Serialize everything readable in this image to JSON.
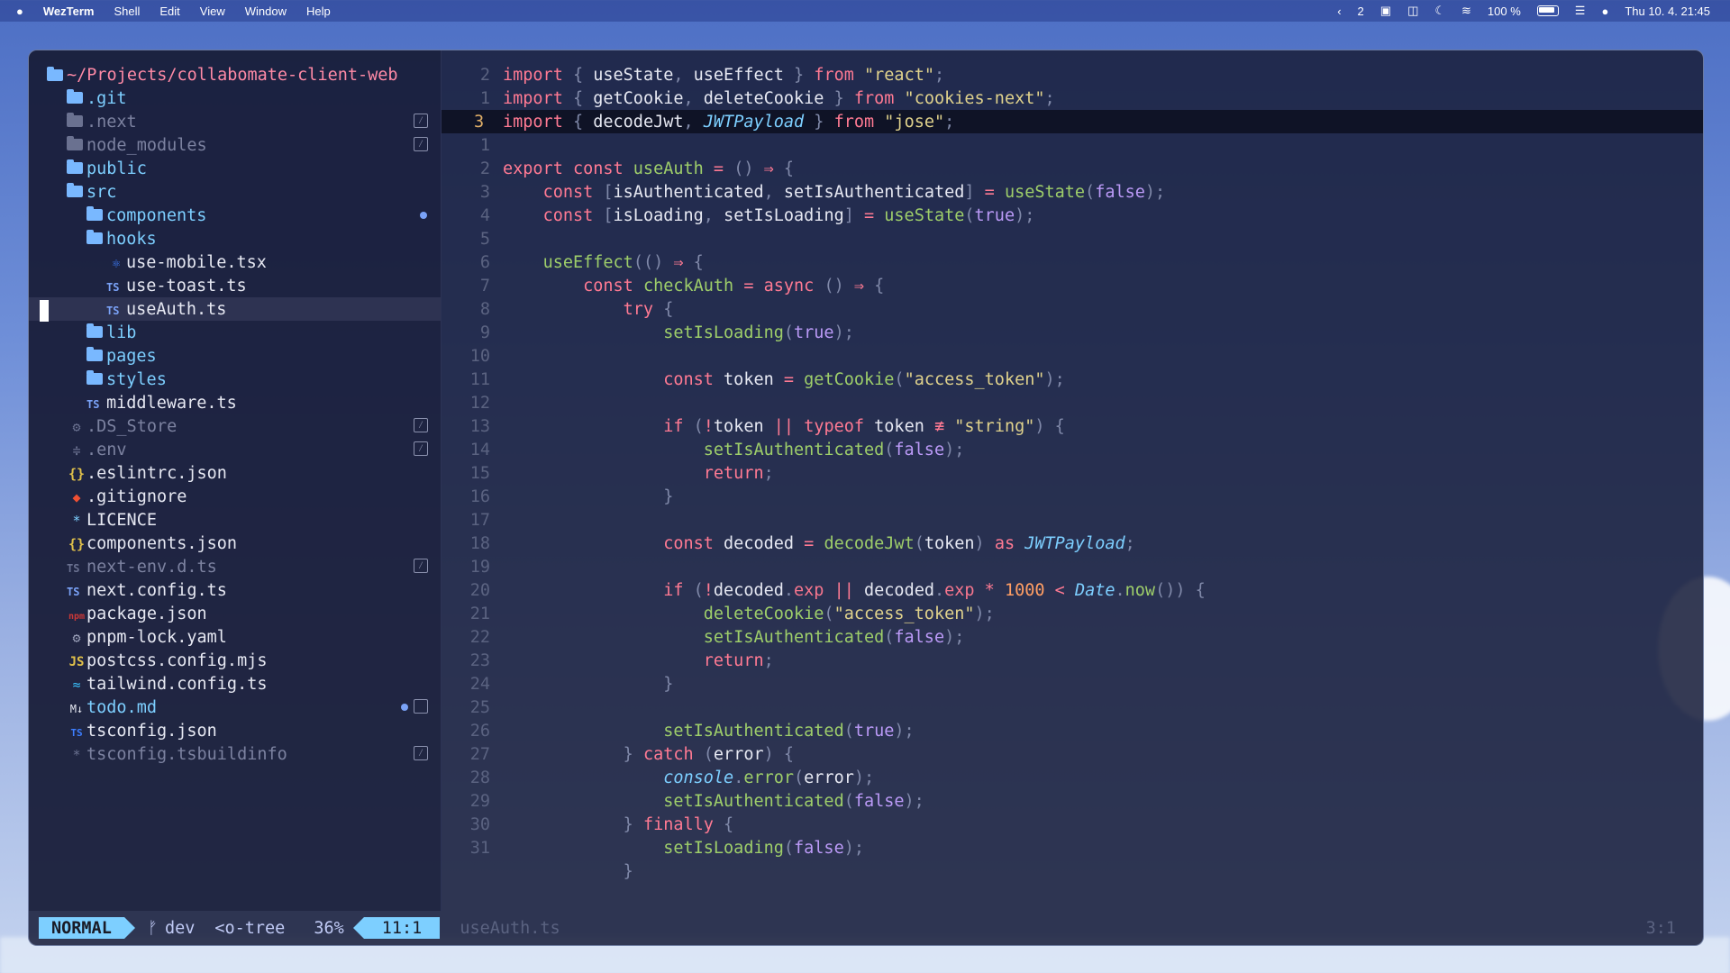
{
  "menubar": {
    "app": "WezTerm",
    "menus": [
      "Shell",
      "Edit",
      "View",
      "Window",
      "Help"
    ],
    "space_number": "2",
    "battery": "100 %",
    "datetime": "Thu 10. 4.  21:45"
  },
  "tree": {
    "root": "~/Projects/collabomate-client-web",
    "items": [
      {
        "name": ".git",
        "type": "folder",
        "depth": 1
      },
      {
        "name": ".next",
        "type": "folder-dim",
        "depth": 1,
        "ignored": true
      },
      {
        "name": "node_modules",
        "type": "folder-dim",
        "depth": 1,
        "ignored": true
      },
      {
        "name": "public",
        "type": "folder",
        "depth": 1
      },
      {
        "name": "src",
        "type": "folder-open",
        "depth": 1
      },
      {
        "name": "components",
        "type": "folder",
        "depth": 2,
        "modified": true
      },
      {
        "name": "hooks",
        "type": "folder-open",
        "depth": 2
      },
      {
        "name": "use-mobile.tsx",
        "type": "tsx",
        "depth": 3
      },
      {
        "name": "use-toast.ts",
        "type": "ts",
        "depth": 3
      },
      {
        "name": "useAuth.ts",
        "type": "ts",
        "depth": 3,
        "selected": true
      },
      {
        "name": "lib",
        "type": "folder",
        "depth": 2
      },
      {
        "name": "pages",
        "type": "folder",
        "depth": 2
      },
      {
        "name": "styles",
        "type": "folder",
        "depth": 2
      },
      {
        "name": "middleware.ts",
        "type": "ts",
        "depth": 2
      },
      {
        "name": ".DS_Store",
        "type": "gear-dim",
        "depth": 1,
        "ignored": true
      },
      {
        "name": ".env",
        "type": "env-dim",
        "depth": 1,
        "ignored": true
      },
      {
        "name": ".eslintrc.json",
        "type": "json",
        "depth": 1
      },
      {
        "name": ".gitignore",
        "type": "git",
        "depth": 1
      },
      {
        "name": "LICENCE",
        "type": "star",
        "depth": 1
      },
      {
        "name": "components.json",
        "type": "json",
        "depth": 1
      },
      {
        "name": "next-env.d.ts",
        "type": "ts-dim",
        "depth": 1,
        "ignored": true
      },
      {
        "name": "next.config.ts",
        "type": "ts",
        "depth": 1
      },
      {
        "name": "package.json",
        "type": "npm",
        "depth": 1
      },
      {
        "name": "pnpm-lock.yaml",
        "type": "gear",
        "depth": 1
      },
      {
        "name": "postcss.config.mjs",
        "type": "js",
        "depth": 1
      },
      {
        "name": "tailwind.config.ts",
        "type": "tailwind",
        "depth": 1
      },
      {
        "name": "todo.md",
        "type": "md",
        "depth": 1,
        "modified": true,
        "unchecked": true
      },
      {
        "name": "tsconfig.json",
        "type": "tsconfig",
        "depth": 1
      },
      {
        "name": "tsconfig.tsbuildinfo",
        "type": "star-dim",
        "depth": 1,
        "ignored": true
      }
    ]
  },
  "editor": {
    "lines": [
      {
        "n": "2",
        "code": [
          [
            "kw",
            "import"
          ],
          [
            "pun",
            " { "
          ],
          [
            "pl",
            "useState"
          ],
          [
            "pun",
            ", "
          ],
          [
            "pl",
            "useEffect"
          ],
          [
            "pun",
            " } "
          ],
          [
            "kw",
            "from"
          ],
          [
            "str",
            " \"react\""
          ],
          [
            "pun",
            ";"
          ]
        ]
      },
      {
        "n": "1",
        "code": [
          [
            "kw",
            "import"
          ],
          [
            "pun",
            " { "
          ],
          [
            "pl",
            "getCookie"
          ],
          [
            "pun",
            ", "
          ],
          [
            "pl",
            "deleteCookie"
          ],
          [
            "pun",
            " } "
          ],
          [
            "kw",
            "from"
          ],
          [
            "str",
            " \"cookies-next\""
          ],
          [
            "pun",
            ";"
          ]
        ]
      },
      {
        "n": "3",
        "current": true,
        "code": [
          [
            "kw",
            "import"
          ],
          [
            "pun",
            " { "
          ],
          [
            "pl",
            "decodeJwt"
          ],
          [
            "pun",
            ", "
          ],
          [
            "ty",
            "JWTPayload"
          ],
          [
            "pun",
            " } "
          ],
          [
            "kw",
            "from"
          ],
          [
            "str",
            " \"jose\""
          ],
          [
            "pun",
            ";"
          ]
        ]
      },
      {
        "n": "1",
        "code": []
      },
      {
        "n": "2",
        "code": [
          [
            "kw",
            "export const "
          ],
          [
            "fn",
            "useAuth"
          ],
          [
            "op",
            " = "
          ],
          [
            "pun",
            "() "
          ],
          [
            "op",
            "⇒"
          ],
          [
            "pun",
            " {"
          ]
        ]
      },
      {
        "n": "3",
        "code": [
          [
            "pl",
            "    "
          ],
          [
            "kw",
            "const "
          ],
          [
            "pun",
            "["
          ],
          [
            "pl",
            "isAuthenticated"
          ],
          [
            "pun",
            ", "
          ],
          [
            "pl",
            "setIsAuthenticated"
          ],
          [
            "pun",
            "]"
          ],
          [
            "op",
            " = "
          ],
          [
            "fn",
            "useState"
          ],
          [
            "pun",
            "("
          ],
          [
            "bool",
            "false"
          ],
          [
            "pun",
            ");"
          ]
        ]
      },
      {
        "n": "4",
        "code": [
          [
            "pl",
            "    "
          ],
          [
            "kw",
            "const "
          ],
          [
            "pun",
            "["
          ],
          [
            "pl",
            "isLoading"
          ],
          [
            "pun",
            ", "
          ],
          [
            "pl",
            "setIsLoading"
          ],
          [
            "pun",
            "]"
          ],
          [
            "op",
            " = "
          ],
          [
            "fn",
            "useState"
          ],
          [
            "pun",
            "("
          ],
          [
            "bool",
            "true"
          ],
          [
            "pun",
            ");"
          ]
        ]
      },
      {
        "n": "5",
        "code": []
      },
      {
        "n": "6",
        "code": [
          [
            "pl",
            "    "
          ],
          [
            "fn",
            "useEffect"
          ],
          [
            "pun",
            "(() "
          ],
          [
            "op",
            "⇒"
          ],
          [
            "pun",
            " {"
          ]
        ]
      },
      {
        "n": "7",
        "code": [
          [
            "pl",
            "        "
          ],
          [
            "kw",
            "const "
          ],
          [
            "fn",
            "checkAuth"
          ],
          [
            "op",
            " = "
          ],
          [
            "kw",
            "async"
          ],
          [
            "pun",
            " () "
          ],
          [
            "op",
            "⇒"
          ],
          [
            "pun",
            " {"
          ]
        ]
      },
      {
        "n": "8",
        "code": [
          [
            "pl",
            "            "
          ],
          [
            "kw",
            "try"
          ],
          [
            "pun",
            " {"
          ]
        ]
      },
      {
        "n": "9",
        "code": [
          [
            "pl",
            "                "
          ],
          [
            "fn",
            "setIsLoading"
          ],
          [
            "pun",
            "("
          ],
          [
            "bool",
            "true"
          ],
          [
            "pun",
            ");"
          ]
        ]
      },
      {
        "n": "10",
        "code": []
      },
      {
        "n": "11",
        "code": [
          [
            "pl",
            "                "
          ],
          [
            "kw",
            "const "
          ],
          [
            "pl",
            "token"
          ],
          [
            "op",
            " = "
          ],
          [
            "fn",
            "getCookie"
          ],
          [
            "pun",
            "("
          ],
          [
            "str",
            "\"access_token\""
          ],
          [
            "pun",
            ");"
          ]
        ]
      },
      {
        "n": "12",
        "code": []
      },
      {
        "n": "13",
        "code": [
          [
            "pl",
            "                "
          ],
          [
            "kw",
            "if"
          ],
          [
            "pun",
            " ("
          ],
          [
            "op",
            "!"
          ],
          [
            "pl",
            "token"
          ],
          [
            "op",
            " || "
          ],
          [
            "kw",
            "typeof"
          ],
          [
            "pl",
            " token "
          ],
          [
            "op",
            "≢"
          ],
          [
            "str",
            " \"string\""
          ],
          [
            "pun",
            ") {"
          ]
        ]
      },
      {
        "n": "14",
        "code": [
          [
            "pl",
            "                    "
          ],
          [
            "fn",
            "setIsAuthenticated"
          ],
          [
            "pun",
            "("
          ],
          [
            "bool",
            "false"
          ],
          [
            "pun",
            ");"
          ]
        ]
      },
      {
        "n": "15",
        "code": [
          [
            "pl",
            "                    "
          ],
          [
            "kw",
            "return"
          ],
          [
            "pun",
            ";"
          ]
        ]
      },
      {
        "n": "16",
        "code": [
          [
            "pl",
            "                "
          ],
          [
            "pun",
            "}"
          ]
        ]
      },
      {
        "n": "17",
        "code": []
      },
      {
        "n": "18",
        "code": [
          [
            "pl",
            "                "
          ],
          [
            "kw",
            "const "
          ],
          [
            "pl",
            "decoded"
          ],
          [
            "op",
            " = "
          ],
          [
            "fn",
            "decodeJwt"
          ],
          [
            "pun",
            "("
          ],
          [
            "pl",
            "token"
          ],
          [
            "pun",
            ") "
          ],
          [
            "kw",
            "as "
          ],
          [
            "ty",
            "JWTPayload"
          ],
          [
            "pun",
            ";"
          ]
        ]
      },
      {
        "n": "19",
        "code": []
      },
      {
        "n": "20",
        "code": [
          [
            "pl",
            "                "
          ],
          [
            "kw",
            "if"
          ],
          [
            "pun",
            " ("
          ],
          [
            "op",
            "!"
          ],
          [
            "pl",
            "decoded"
          ],
          [
            "pun",
            "."
          ],
          [
            "prop",
            "exp"
          ],
          [
            "op",
            " || "
          ],
          [
            "pl",
            "decoded"
          ],
          [
            "pun",
            "."
          ],
          [
            "prop",
            "exp"
          ],
          [
            "op",
            " * "
          ],
          [
            "num",
            "1000"
          ],
          [
            "op",
            " < "
          ],
          [
            "ty",
            "Date"
          ],
          [
            "pun",
            "."
          ],
          [
            "fn",
            "now"
          ],
          [
            "pun",
            "()) {"
          ]
        ]
      },
      {
        "n": "21",
        "code": [
          [
            "pl",
            "                    "
          ],
          [
            "fn",
            "deleteCookie"
          ],
          [
            "pun",
            "("
          ],
          [
            "str",
            "\"access_token\""
          ],
          [
            "pun",
            ");"
          ]
        ]
      },
      {
        "n": "22",
        "code": [
          [
            "pl",
            "                    "
          ],
          [
            "fn",
            "setIsAuthenticated"
          ],
          [
            "pun",
            "("
          ],
          [
            "bool",
            "false"
          ],
          [
            "pun",
            ");"
          ]
        ]
      },
      {
        "n": "23",
        "code": [
          [
            "pl",
            "                    "
          ],
          [
            "kw",
            "return"
          ],
          [
            "pun",
            ";"
          ]
        ]
      },
      {
        "n": "24",
        "code": [
          [
            "pl",
            "                "
          ],
          [
            "pun",
            "}"
          ]
        ]
      },
      {
        "n": "25",
        "code": []
      },
      {
        "n": "26",
        "code": [
          [
            "pl",
            "                "
          ],
          [
            "fn",
            "setIsAuthenticated"
          ],
          [
            "pun",
            "("
          ],
          [
            "bool",
            "true"
          ],
          [
            "pun",
            ");"
          ]
        ]
      },
      {
        "n": "27",
        "code": [
          [
            "pl",
            "            "
          ],
          [
            "pun",
            "} "
          ],
          [
            "kw",
            "catch"
          ],
          [
            "pun",
            " ("
          ],
          [
            "pl",
            "error"
          ],
          [
            "pun",
            ") {"
          ]
        ]
      },
      {
        "n": "28",
        "code": [
          [
            "pl",
            "                "
          ],
          [
            "ty",
            "console"
          ],
          [
            "pun",
            "."
          ],
          [
            "fn",
            "error"
          ],
          [
            "pun",
            "("
          ],
          [
            "pl",
            "error"
          ],
          [
            "pun",
            ");"
          ]
        ]
      },
      {
        "n": "29",
        "code": [
          [
            "pl",
            "                "
          ],
          [
            "fn",
            "setIsAuthenticated"
          ],
          [
            "pun",
            "("
          ],
          [
            "bool",
            "false"
          ],
          [
            "pun",
            ");"
          ]
        ]
      },
      {
        "n": "30",
        "code": [
          [
            "pl",
            "            "
          ],
          [
            "pun",
            "} "
          ],
          [
            "kw",
            "finally"
          ],
          [
            "pun",
            " {"
          ]
        ]
      },
      {
        "n": "31",
        "code": [
          [
            "pl",
            "                "
          ],
          [
            "fn",
            "setIsLoading"
          ],
          [
            "pun",
            "("
          ],
          [
            "bool",
            "false"
          ],
          [
            "pun",
            ");"
          ]
        ]
      },
      {
        "n": "",
        "code": [
          [
            "pl",
            "            "
          ],
          [
            "pun",
            "}"
          ]
        ]
      }
    ]
  },
  "statusline": {
    "mode": "NORMAL",
    "branch_icon": "ᚠ",
    "branch": "dev",
    "buffer": "<o-tree",
    "percent": "36%",
    "position": "11:1",
    "filename": "useAuth.ts",
    "cursor_pos": "3:1"
  },
  "colors": {
    "accent": "#7dcfff",
    "keyword": "#ff7a93",
    "function": "#9ece6a",
    "string": "#e0d28c"
  }
}
